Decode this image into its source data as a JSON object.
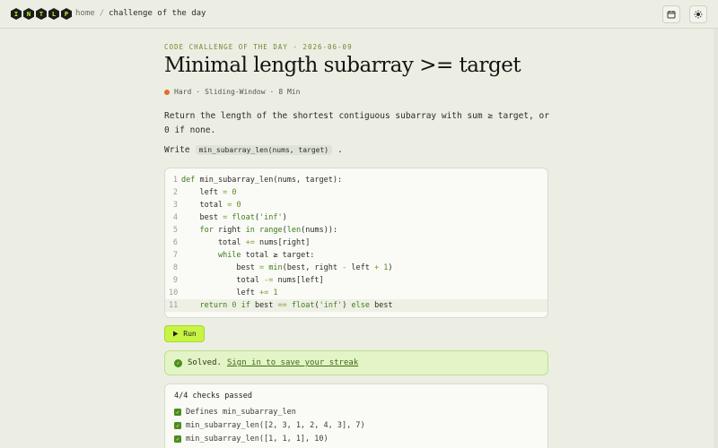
{
  "header": {
    "logo_letters": [
      "I",
      "N",
      "T",
      "L",
      "P"
    ],
    "breadcrumb": {
      "home": "home",
      "separator": "/",
      "current": "challenge of the day"
    },
    "icons": [
      "calendar-icon",
      "sun-icon"
    ]
  },
  "challenge": {
    "eyebrow": "CODE CHALLENGE OF THE DAY · 2026-06-09",
    "title": "Minimal length subarray >= target",
    "meta": {
      "difficulty": "Hard",
      "tag": "Sliding-Window",
      "time": "8 Min",
      "difficulty_color": "#e8692f"
    },
    "description": "Return the length of the shortest contiguous subarray with sum ≥ target, or 0 if none.",
    "write_label": "Write",
    "write_signature": "min_subarray_len(nums, target)",
    "write_suffix": "."
  },
  "editor": {
    "lines": [
      "def min_subarray_len(nums, target):",
      "    left = 0",
      "    total = 0",
      "    best = float('inf')",
      "    for right in range(len(nums)):",
      "        total += nums[right]",
      "        while total ≥ target:",
      "            best = min(best, right - left + 1)",
      "            total -= nums[left]",
      "            left += 1",
      "    return 0 if best == float('inf') else best"
    ],
    "active_line": 11
  },
  "run_button": {
    "label": "Run",
    "icon": "play-icon"
  },
  "result": {
    "status": "Solved.",
    "link": "Sign in to save your streak"
  },
  "checks": {
    "title": "4/4 checks passed",
    "items": [
      "Defines min_subarray_len",
      "min_subarray_len([2, 3, 1, 2, 4, 3], 7)",
      "min_subarray_len([1, 1, 1], 10)"
    ]
  },
  "colors": {
    "accent": "#c8f545",
    "success": "#4a8d1c",
    "background": "#eceee4"
  }
}
